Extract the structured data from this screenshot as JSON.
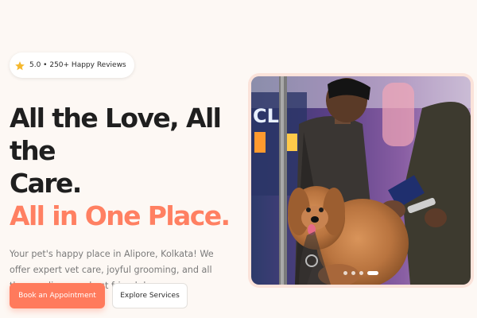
{
  "badge": {
    "icon": "star-icon",
    "text": "5.0 • 250+ Happy Reviews"
  },
  "hero": {
    "headline_line1": "All the Love, All the",
    "headline_line2": "Care.",
    "headline_accent": "All in One Place.",
    "description": "Your pet's happy place in Alipore, Kolkata! We offer expert vet care, joyful grooming, and all the supplies your best friend deserves."
  },
  "buttons": {
    "primary_label": "Book an Appointment",
    "secondary_label": "Explore Services"
  },
  "carousel": {
    "image_subject": "groomer holding a fluffy brown dog",
    "slide_count": 4,
    "active_index": 3
  },
  "colors": {
    "accent": "#ff7a5c",
    "background": "#fdf8f4",
    "heading": "#1f1f1f",
    "body_text": "#7a7a7a"
  }
}
